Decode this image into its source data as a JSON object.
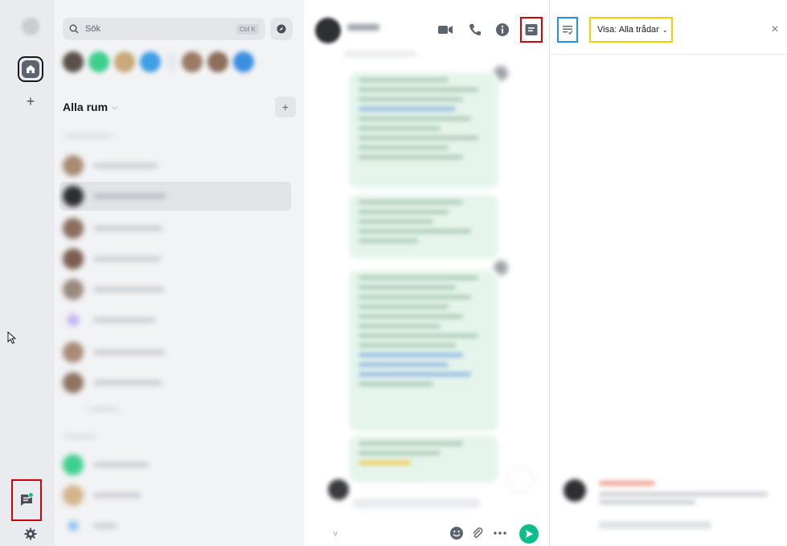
{
  "rail": {
    "home_icon": "home-icon",
    "create_space_label": "+",
    "threads_icon": "threads-icon",
    "settings_icon": "gear-icon"
  },
  "roomlist": {
    "search_placeholder": "Sök",
    "search_shortcut": "Ctrl K",
    "header_title": "Alla rum",
    "add_label": "+"
  },
  "timeline": {
    "footer_v": "v"
  },
  "threads_panel": {
    "filter_label": "Visa: Alla trådar",
    "close_label": "×"
  },
  "colors": {
    "accent": "#0dbd8b",
    "highlight_red": "#d50000",
    "highlight_blue": "#1e90ff",
    "highlight_yellow": "#f0d000"
  }
}
